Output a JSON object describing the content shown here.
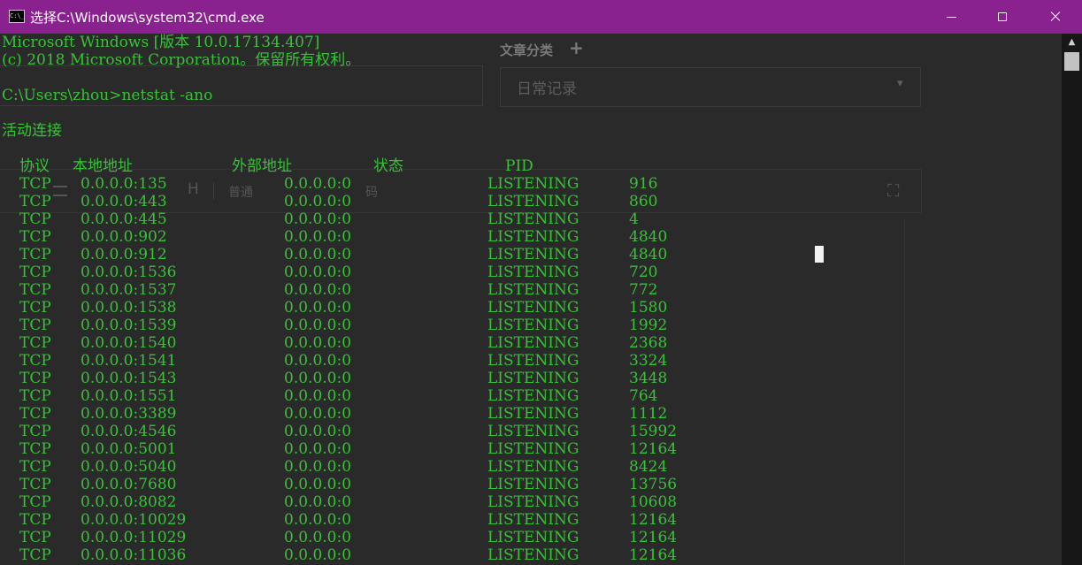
{
  "window": {
    "title": "选择C:\\Windows\\system32\\cmd.exe",
    "icon_text": "C:\\_",
    "colors": {
      "titlebar": "#89218f",
      "console_text": "#36c436",
      "console_bg": "#2a2a2a"
    }
  },
  "background_app": {
    "category_label": "文章分类",
    "add_icon": "+",
    "category_value": "日常记录",
    "dropdown_caret": "▾",
    "toolbar_style": "普通",
    "toolbar_code": "码",
    "toolbar_bold": "H",
    "fullscreen_icon": "⛶"
  },
  "console": {
    "banner_line1": "Microsoft Windows [版本 10.0.17134.407]",
    "banner_line2": "(c) 2018 Microsoft Corporation。保留所有权利。",
    "prompt": "C:\\Users\\zhou>netstat -ano",
    "section_title": "活动连接",
    "headers": {
      "proto": "协议",
      "local": "本地地址",
      "foreign": "外部地址",
      "state": "状态",
      "pid": "PID"
    },
    "rows": [
      {
        "proto": "TCP",
        "local": "0.0.0.0:135",
        "foreign": "0.0.0.0:0",
        "state": "LISTENING",
        "pid": "916"
      },
      {
        "proto": "TCP",
        "local": "0.0.0.0:443",
        "foreign": "0.0.0.0:0",
        "state": "LISTENING",
        "pid": "860"
      },
      {
        "proto": "TCP",
        "local": "0.0.0.0:445",
        "foreign": "0.0.0.0:0",
        "state": "LISTENING",
        "pid": "4"
      },
      {
        "proto": "TCP",
        "local": "0.0.0.0:902",
        "foreign": "0.0.0.0:0",
        "state": "LISTENING",
        "pid": "4840"
      },
      {
        "proto": "TCP",
        "local": "0.0.0.0:912",
        "foreign": "0.0.0.0:0",
        "state": "LISTENING",
        "pid": "4840"
      },
      {
        "proto": "TCP",
        "local": "0.0.0.0:1536",
        "foreign": "0.0.0.0:0",
        "state": "LISTENING",
        "pid": "720"
      },
      {
        "proto": "TCP",
        "local": "0.0.0.0:1537",
        "foreign": "0.0.0.0:0",
        "state": "LISTENING",
        "pid": "772"
      },
      {
        "proto": "TCP",
        "local": "0.0.0.0:1538",
        "foreign": "0.0.0.0:0",
        "state": "LISTENING",
        "pid": "1580"
      },
      {
        "proto": "TCP",
        "local": "0.0.0.0:1539",
        "foreign": "0.0.0.0:0",
        "state": "LISTENING",
        "pid": "1992"
      },
      {
        "proto": "TCP",
        "local": "0.0.0.0:1540",
        "foreign": "0.0.0.0:0",
        "state": "LISTENING",
        "pid": "2368"
      },
      {
        "proto": "TCP",
        "local": "0.0.0.0:1541",
        "foreign": "0.0.0.0:0",
        "state": "LISTENING",
        "pid": "3324"
      },
      {
        "proto": "TCP",
        "local": "0.0.0.0:1543",
        "foreign": "0.0.0.0:0",
        "state": "LISTENING",
        "pid": "3448"
      },
      {
        "proto": "TCP",
        "local": "0.0.0.0:1551",
        "foreign": "0.0.0.0:0",
        "state": "LISTENING",
        "pid": "764"
      },
      {
        "proto": "TCP",
        "local": "0.0.0.0:3389",
        "foreign": "0.0.0.0:0",
        "state": "LISTENING",
        "pid": "1112"
      },
      {
        "proto": "TCP",
        "local": "0.0.0.0:4546",
        "foreign": "0.0.0.0:0",
        "state": "LISTENING",
        "pid": "15992"
      },
      {
        "proto": "TCP",
        "local": "0.0.0.0:5001",
        "foreign": "0.0.0.0:0",
        "state": "LISTENING",
        "pid": "12164"
      },
      {
        "proto": "TCP",
        "local": "0.0.0.0:5040",
        "foreign": "0.0.0.0:0",
        "state": "LISTENING",
        "pid": "8424"
      },
      {
        "proto": "TCP",
        "local": "0.0.0.0:7680",
        "foreign": "0.0.0.0:0",
        "state": "LISTENING",
        "pid": "13756"
      },
      {
        "proto": "TCP",
        "local": "0.0.0.0:8082",
        "foreign": "0.0.0.0:0",
        "state": "LISTENING",
        "pid": "10608"
      },
      {
        "proto": "TCP",
        "local": "0.0.0.0:10029",
        "foreign": "0.0.0.0:0",
        "state": "LISTENING",
        "pid": "12164"
      },
      {
        "proto": "TCP",
        "local": "0.0.0.0:11029",
        "foreign": "0.0.0.0:0",
        "state": "LISTENING",
        "pid": "12164"
      },
      {
        "proto": "TCP",
        "local": "0.0.0.0:11036",
        "foreign": "0.0.0.0:0",
        "state": "LISTENING",
        "pid": "12164"
      }
    ]
  }
}
